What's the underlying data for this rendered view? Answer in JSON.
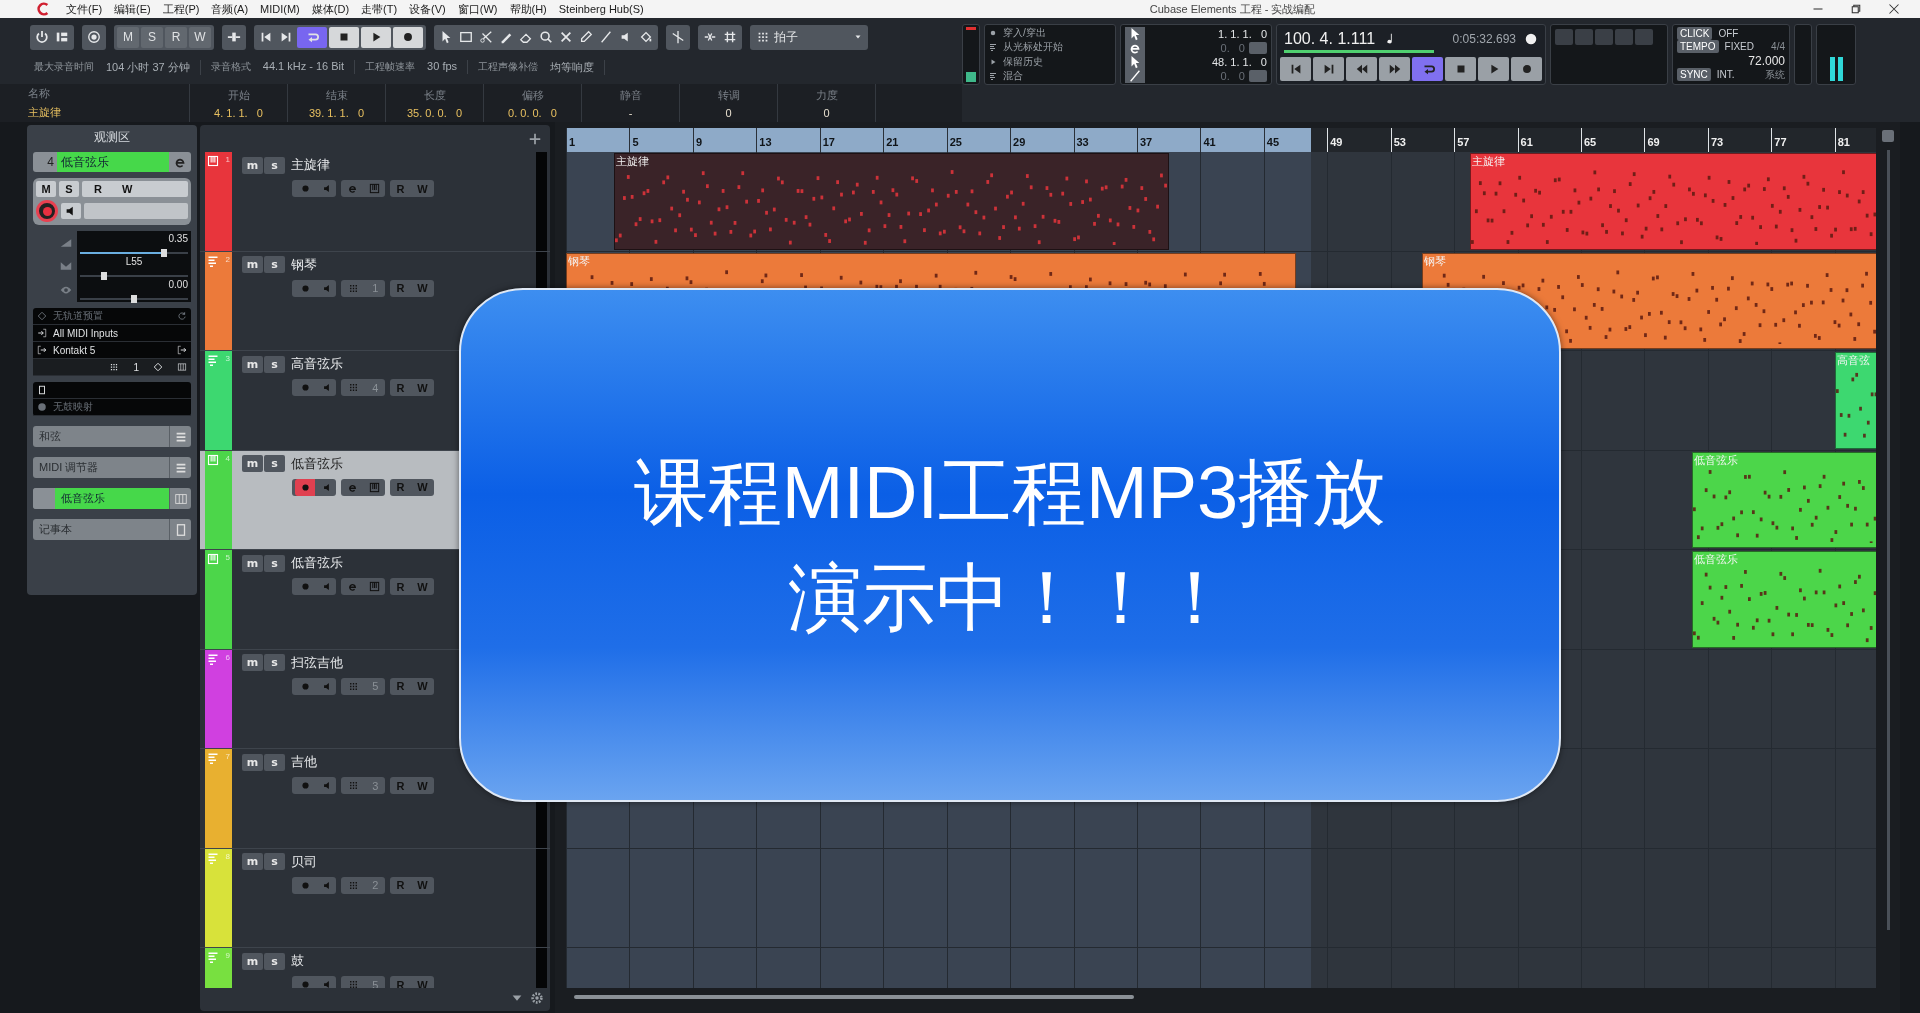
{
  "menu_bar": {
    "items": [
      "文件(F)",
      "编辑(E)",
      "工程(P)",
      "音频(A)",
      "MIDI(M)",
      "媒体(D)",
      "走带(T)",
      "设备(V)",
      "窗口(W)",
      "帮助(H)",
      "Steinberg Hub(S)"
    ],
    "title": "Cubase Elements 工程 - 实战编配"
  },
  "toolbar": {
    "mode_buttons": [
      "M",
      "S",
      "R",
      "W"
    ],
    "cycle_on": true,
    "grid_type": "拍子"
  },
  "status_line": [
    {
      "label": "最大录音时间",
      "value": "104 小时 37 分钟"
    },
    {
      "label": "录音格式",
      "value": "44.1 kHz - 16 Bit"
    },
    {
      "label": "工程帧速率",
      "value": "30 fps"
    },
    {
      "label": "工程声像补偿",
      "value": "均等响度"
    }
  ],
  "info_line": [
    {
      "label": "名称",
      "value": "主旋律"
    },
    {
      "label": "开始",
      "value": "4. 1. 1.   0"
    },
    {
      "label": "结束",
      "value": "39. 1. 1.   0"
    },
    {
      "label": "长度",
      "value": "35. 0. 0.   0"
    },
    {
      "label": "偏移",
      "value": "0. 0. 0.   0"
    },
    {
      "label": "静音",
      "value": "-"
    },
    {
      "label": "转调",
      "value": "0"
    },
    {
      "label": "力度",
      "value": "0"
    }
  ],
  "transport": {
    "options": [
      "穿入/穿出",
      "从光标处开始",
      "保留历史",
      "混合"
    ],
    "left_locator": "1. 1. 1.   0",
    "left_offset": "0.   0",
    "right_locator": "48. 1. 1.   0",
    "right_offset": "0.   0",
    "position": "100. 4. 1.111",
    "time": "0:05:32.693",
    "cycle_on": true,
    "click": {
      "label": "CLICK",
      "value": "OFF"
    },
    "tempo": {
      "label": "TEMPO",
      "mode": "FIXED",
      "signature": "4/4",
      "bpm": "72.000"
    },
    "sync": {
      "label": "SYNC",
      "value": "INT.",
      "source": "系统"
    }
  },
  "inspector": {
    "title": "观测区",
    "track": {
      "number": "4",
      "name": "低音弦乐"
    },
    "buttons": [
      "M",
      "S",
      "R",
      "W"
    ],
    "record_enabled": true,
    "volume": {
      "reading": "0.35",
      "level": 0.78
    },
    "pan": {
      "reading": "L55",
      "level": 0.22
    },
    "delay": {
      "reading": "0.00",
      "level": 0.5
    },
    "preset": "无轨道预置",
    "input": "All MIDI Inputs",
    "output": "Kontakt 5",
    "channel": "1",
    "drum_map": "无鼓映射",
    "sections": [
      {
        "label": "和弦",
        "kind": "plain"
      },
      {
        "label": "MIDI 调节器",
        "kind": "plain"
      },
      {
        "label": "低音弦乐",
        "kind": "channel"
      },
      {
        "label": "记事本",
        "kind": "plain"
      }
    ]
  },
  "ruler": {
    "marks": [
      "1",
      "5",
      "9",
      "13",
      "17",
      "21",
      "25",
      "29",
      "33",
      "37",
      "41",
      "45",
      "49",
      "53",
      "57",
      "61",
      "65",
      "69",
      "73",
      "77",
      "81"
    ]
  },
  "tracks": [
    {
      "number": "1",
      "name": "主旋律",
      "kind": "instrument",
      "color": "#e8353c",
      "selected": false,
      "record_enabled": false,
      "buttons": [
        "m",
        "s",
        "R",
        "W"
      ],
      "parts": [
        {
          "name": "主旋律",
          "selected": true
        },
        {
          "name": "主旋律",
          "selected": false
        }
      ]
    },
    {
      "number": "2",
      "name": "钢琴",
      "kind": "midi",
      "channel": "1",
      "color": "#ec7a3a",
      "selected": false,
      "record_enabled": false,
      "buttons": [
        "m",
        "s",
        "R",
        "W"
      ],
      "parts": [
        {
          "name": "钢琴",
          "selected": false
        },
        {
          "name": "钢琴",
          "selected": false
        }
      ]
    },
    {
      "number": "3",
      "name": "高音弦乐",
      "kind": "midi",
      "channel": "4",
      "color": "#3dd870",
      "selected": false,
      "record_enabled": false,
      "buttons": [
        "m",
        "s",
        "R",
        "W"
      ],
      "parts": [
        {
          "name": "高音弦",
          "selected": false
        }
      ]
    },
    {
      "number": "4",
      "name": "低音弦乐",
      "kind": "instrument",
      "color": "#4cd64a",
      "selected": true,
      "record_enabled": true,
      "buttons": [
        "m",
        "s",
        "R",
        "W"
      ],
      "parts": [
        {
          "name": "低音弦乐",
          "selected": false
        }
      ]
    },
    {
      "number": "5",
      "name": "低音弦乐",
      "kind": "instrument",
      "color": "#4cd64a",
      "selected": false,
      "record_enabled": false,
      "buttons": [
        "m",
        "s",
        "R",
        "W"
      ],
      "parts": [
        {
          "name": "低音弦乐",
          "selected": false
        }
      ]
    },
    {
      "number": "6",
      "name": "扫弦吉他",
      "kind": "midi",
      "channel": "5",
      "color": "#d040e0",
      "selected": false,
      "record_enabled": false,
      "buttons": [
        "m",
        "s",
        "R",
        "W"
      ]
    },
    {
      "number": "7",
      "name": "吉他",
      "kind": "midi",
      "channel": "3",
      "color": "#e8b030",
      "selected": false,
      "record_enabled": false,
      "buttons": [
        "m",
        "s",
        "R",
        "W"
      ]
    },
    {
      "number": "8",
      "name": "贝司",
      "kind": "midi",
      "channel": "2",
      "color": "#d8e23a",
      "selected": false,
      "record_enabled": false,
      "buttons": [
        "m",
        "s",
        "R",
        "W"
      ]
    },
    {
      "number": "9",
      "name": "鼓",
      "kind": "midi",
      "channel": "5",
      "color": "#78e040",
      "selected": false,
      "record_enabled": false,
      "buttons": [
        "m",
        "s",
        "R",
        "W"
      ]
    }
  ],
  "overlay": {
    "lines": [
      "课程MIDI工程MP3播放",
      "演示中！！！"
    ]
  }
}
